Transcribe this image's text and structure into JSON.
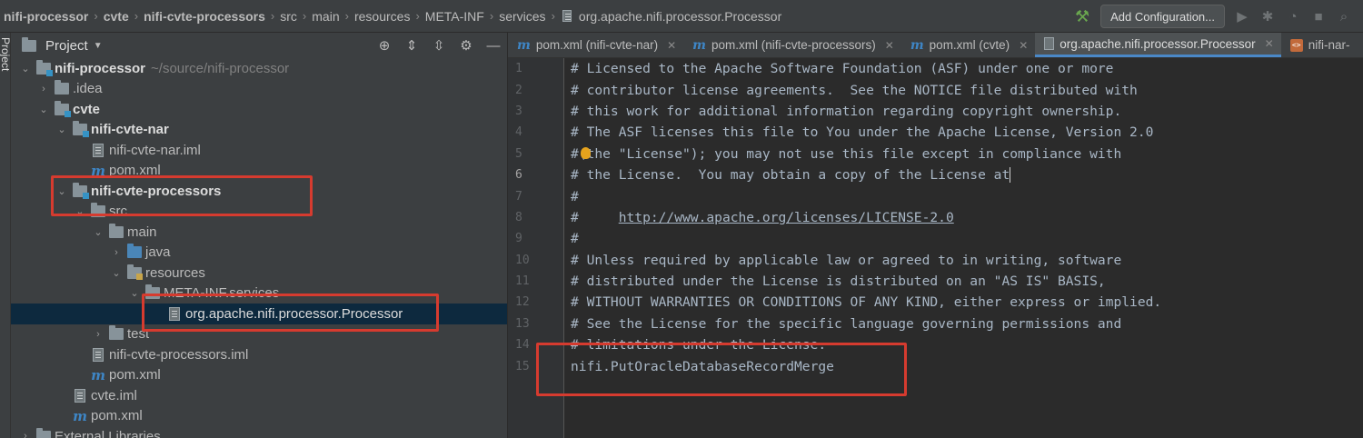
{
  "breadcrumb": [
    "nifi-processor",
    "cvte",
    "nifi-cvte-processors",
    "src",
    "main",
    "resources",
    "META-INF",
    "services",
    "org.apache.nifi.processor.Processor"
  ],
  "toolbar": {
    "add_configuration": "Add Configuration..."
  },
  "stripe": {
    "label": "Project"
  },
  "project_panel": {
    "title": "Project"
  },
  "tree": [
    {
      "label": "nifi-processor",
      "path": "~/source/nifi-processor"
    },
    {
      "label": ".idea"
    },
    {
      "label": "cvte"
    },
    {
      "label": "nifi-cvte-nar"
    },
    {
      "label": "nifi-cvte-nar.iml"
    },
    {
      "label": "pom.xml"
    },
    {
      "label": "nifi-cvte-processors"
    },
    {
      "label": "src"
    },
    {
      "label": "main"
    },
    {
      "label": "java"
    },
    {
      "label": "resources"
    },
    {
      "label": "META-INF.services"
    },
    {
      "label": "org.apache.nifi.processor.Processor"
    },
    {
      "label": "test"
    },
    {
      "label": "nifi-cvte-processors.iml"
    },
    {
      "label": "pom.xml"
    },
    {
      "label": "cvte.iml"
    },
    {
      "label": "pom.xml"
    },
    {
      "label": "External Libraries"
    }
  ],
  "tabs": [
    {
      "label": "pom.xml (nifi-cvte-nar)"
    },
    {
      "label": "pom.xml (nifi-cvte-processors)"
    },
    {
      "label": "pom.xml (cvte)"
    },
    {
      "label": "org.apache.nifi.processor.Processor"
    },
    {
      "label": "nifi-nar-"
    }
  ],
  "editor": {
    "current_line": 6,
    "lines": [
      "# Licensed to the Apache Software Foundation (ASF) under one or more",
      "# contributor license agreements.  See the NOTICE file distributed with",
      "# this work for additional information regarding copyright ownership.",
      "# The ASF licenses this file to You under the Apache License, Version 2.0",
      "#(the \"License\"); you may not use this file except in compliance with",
      "# the License.  You may obtain a copy of the License at",
      "#",
      "#     ",
      "#",
      "# Unless required by applicable law or agreed to in writing, software",
      "# distributed under the License is distributed on an \"AS IS\" BASIS,",
      "# WITHOUT WARRANTIES OR CONDITIONS OF ANY KIND, either express or implied.",
      "# See the License for the specific language governing permissions and",
      "# limitations under the License.",
      "nifi.PutOracleDatabaseRecordMerge"
    ],
    "line_numbers": [
      "1",
      "2",
      "3",
      "4",
      "5",
      "6",
      "7",
      "8",
      "9",
      "10",
      "11",
      "12",
      "13",
      "14",
      "15"
    ],
    "license_url": "http://www.apache.org/licenses/LICENSE-2.0"
  },
  "colors": {
    "highlight": "#d63b2f",
    "selection": "#0d293e",
    "accent": "#4a88c7"
  }
}
